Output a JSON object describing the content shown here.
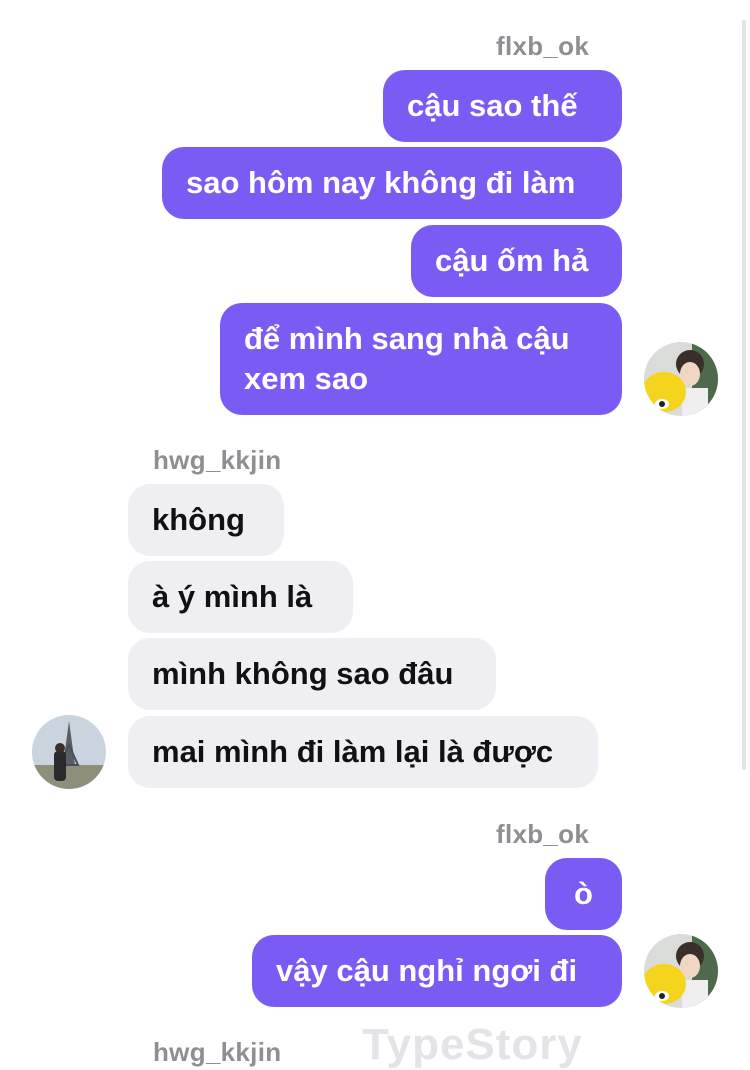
{
  "chat": {
    "block1": {
      "sender": "flxb_ok",
      "messages": [
        "cậu sao thế",
        "sao hôm nay không đi làm",
        "cậu ốm hả",
        "để mình sang nhà cậu",
        "xem sao"
      ]
    },
    "block2": {
      "sender": "hwg_kkjin",
      "messages": [
        "không",
        "à ý mình là",
        "mình không sao đâu",
        "mai mình đi làm lại là được"
      ]
    },
    "block3": {
      "sender": "flxb_ok",
      "messages": [
        "ò",
        "vậy cậu nghỉ ngơi đi"
      ]
    },
    "block4": {
      "sender": "hwg_kkjin"
    }
  },
  "watermark": "TypeStory",
  "colors": {
    "outgoing_bubble": "#7a5cf5",
    "incoming_bubble": "#efeff3",
    "name_text": "#8e8e93"
  }
}
